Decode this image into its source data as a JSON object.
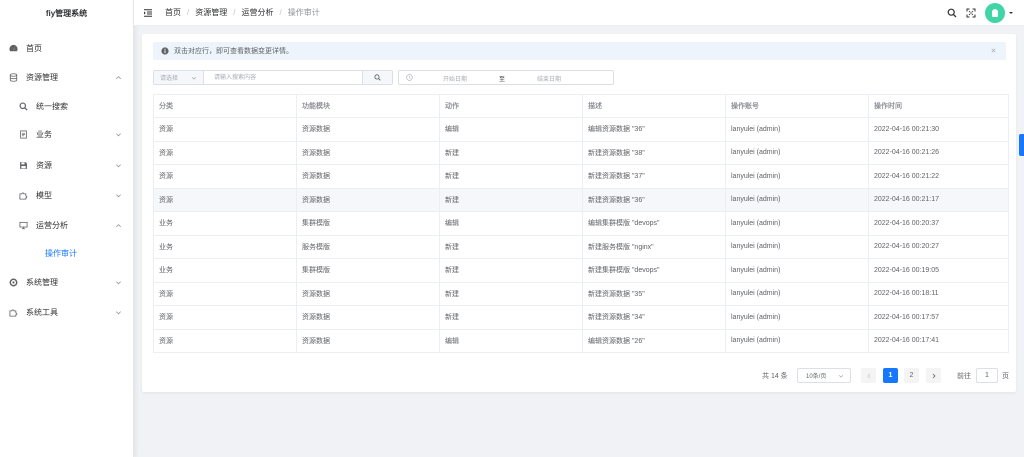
{
  "sidebar": {
    "logo": "fiy管理系统",
    "items": [
      {
        "label": "首页",
        "icon": "dashboard-icon"
      },
      {
        "label": "资源管理",
        "icon": "database-icon"
      },
      {
        "label": "统一搜索",
        "icon": "search-icon"
      },
      {
        "label": "业务",
        "icon": "document-icon"
      },
      {
        "label": "资源",
        "icon": "save-icon"
      },
      {
        "label": "模型",
        "icon": "puzzle-icon"
      },
      {
        "label": "运营分析",
        "icon": "monitor-icon"
      },
      {
        "label": "操作审计",
        "icon": ""
      },
      {
        "label": "系统管理",
        "icon": "settings-icon"
      },
      {
        "label": "系统工具",
        "icon": "tool-icon"
      }
    ]
  },
  "header": {
    "breadcrumb": [
      "首页",
      "资源管理",
      "运营分析",
      "操作审计"
    ]
  },
  "alert": {
    "text": "双击对应行，即可查看数据变更详情。"
  },
  "search": {
    "select_placeholder": "请选择",
    "input_placeholder": "请输入搜索内容"
  },
  "daterange": {
    "start_placeholder": "开始日期",
    "separator": "至",
    "end_placeholder": "结束日期"
  },
  "table": {
    "columns": [
      "分类",
      "功能模块",
      "动作",
      "描述",
      "操作账号",
      "操作时间"
    ],
    "rows": [
      [
        "资源",
        "资源数据",
        "编辑",
        "编辑资源数据 \"36\"",
        "lanyulei (admin)",
        "2022-04-16 00:21:30"
      ],
      [
        "资源",
        "资源数据",
        "新建",
        "新建资源数据 \"38\"",
        "lanyulei (admin)",
        "2022-04-16 00:21:26"
      ],
      [
        "资源",
        "资源数据",
        "新建",
        "新建资源数据 \"37\"",
        "lanyulei (admin)",
        "2022-04-16 00:21:22"
      ],
      [
        "资源",
        "资源数据",
        "新建",
        "新建资源数据 \"36\"",
        "lanyulei (admin)",
        "2022-04-16 00:21:17"
      ],
      [
        "业务",
        "集群模版",
        "编辑",
        "编辑集群模版 \"devops\"",
        "lanyulei (admin)",
        "2022-04-16 00:20:37"
      ],
      [
        "业务",
        "服务模版",
        "新建",
        "新建服务模版 \"nginx\"",
        "lanyulei (admin)",
        "2022-04-16 00:20:27"
      ],
      [
        "业务",
        "集群模版",
        "新建",
        "新建集群模版 \"devops\"",
        "lanyulei (admin)",
        "2022-04-16 00:19:05"
      ],
      [
        "资源",
        "资源数据",
        "新建",
        "新建资源数据 \"35\"",
        "lanyulei (admin)",
        "2022-04-16 00:18:11"
      ],
      [
        "资源",
        "资源数据",
        "新建",
        "新建资源数据 \"34\"",
        "lanyulei (admin)",
        "2022-04-16 00:17:57"
      ],
      [
        "资源",
        "资源数据",
        "编辑",
        "编辑资源数据 \"26\"",
        "lanyulei (admin)",
        "2022-04-16 00:17:41"
      ]
    ]
  },
  "pagination": {
    "total": "共 14 条",
    "page_size": "10条/页",
    "pages": [
      "1",
      "2"
    ],
    "goto_prefix": "前往",
    "goto_value": "1",
    "goto_suffix": "页"
  },
  "colors": {
    "accent": "#1677ff",
    "avatar": "#40d4a6",
    "alert_bg": "#edf4fc"
  }
}
